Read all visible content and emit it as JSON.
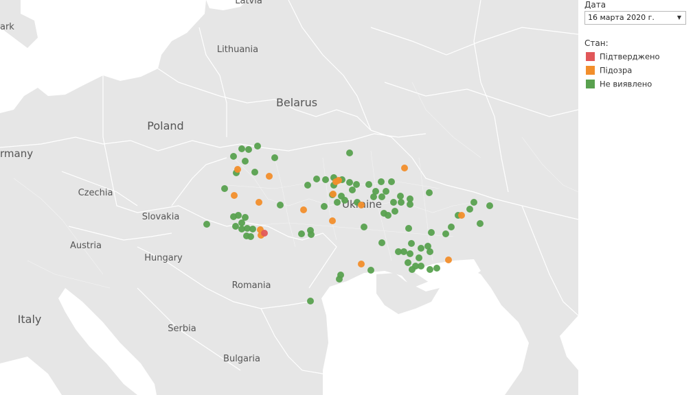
{
  "map": {
    "country_labels": [
      "Latvia",
      "Lithuania",
      "Belarus",
      "Poland",
      "rmany",
      "ark",
      "Czechia",
      "Slovakia",
      "Austria",
      "Hungary",
      "Ukraine",
      "Romania",
      "Serbia",
      "Bulgaria",
      "Italy"
    ],
    "colors": {
      "land": "#e6e6e6",
      "sea": "#ffffff",
      "border": "#ffffff",
      "confirmed": "#e15759",
      "suspected": "#f28e2b",
      "not_detected": "#59a14f"
    }
  },
  "filter": {
    "title": "Дата",
    "selected": "16 марта 2020 г."
  },
  "legend": {
    "title": "Стан:",
    "items": [
      {
        "label": "Підтверджено",
        "color": "#e15759"
      },
      {
        "label": "Підозра",
        "color": "#f28e2b"
      },
      {
        "label": "Не виявлено",
        "color": "#59a14f"
      }
    ]
  }
}
